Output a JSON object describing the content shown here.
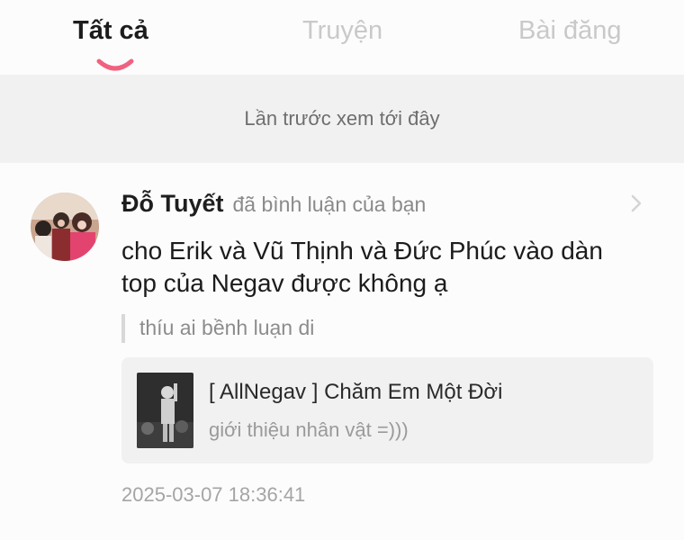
{
  "tabs": [
    {
      "label": "Tất cả",
      "active": true
    },
    {
      "label": "Truyện",
      "active": false
    },
    {
      "label": "Bài đăng",
      "active": false
    }
  ],
  "accent_color": "#f0627f",
  "history": {
    "label": "Lần trước xem tới đây"
  },
  "notification": {
    "user_name": "Đỗ Tuyết",
    "action": "đã bình luận của bạn",
    "comment": "cho Erik và Vũ Thịnh và Đức Phúc vào dàn top của Negav được không ạ",
    "quoted_comment": "thíu ai bềnh luạn di",
    "story": {
      "title": "[ AllNegav ] Chăm Em Một Đời",
      "subtitle": "giới thiệu nhân vật =)))"
    },
    "timestamp": "2025-03-07 18:36:41"
  },
  "icons": {
    "chevron": "chevron-right-icon",
    "avatar": "user-avatar",
    "thumbnail": "story-cover-thumbnail"
  }
}
